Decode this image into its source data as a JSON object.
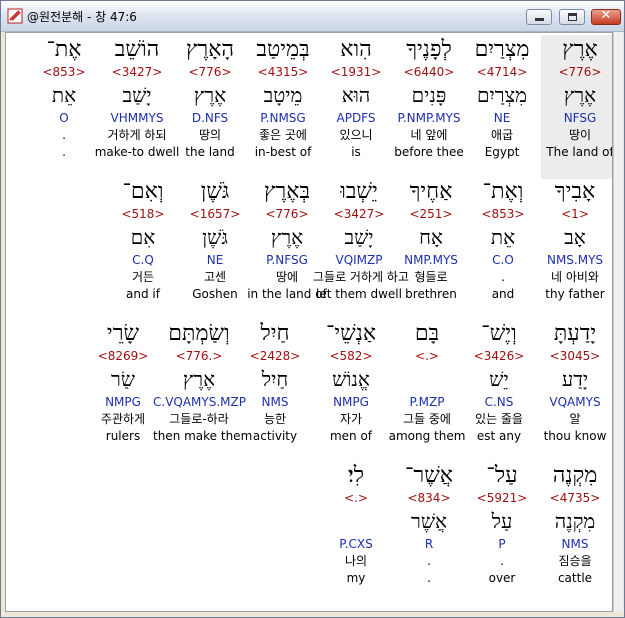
{
  "window": {
    "title": "@원전분해 - 창 47:6",
    "close_glyph": "✕"
  },
  "rows": [
    {
      "words": [
        {
          "heb": "אֶרֶץ",
          "strong": "<776>",
          "lex": "אֶרֶץ",
          "morph": "NFSG",
          "kor": "땅이",
          "eng": "The land of",
          "highlight": true
        },
        {
          "heb": "מִצְרַיִם",
          "strong": "<4714>",
          "lex": "מִצְרַיִם",
          "morph": "NE",
          "kor": "애굽",
          "eng": "Egypt"
        },
        {
          "heb": "לְפָנֶיךָ",
          "strong": "<6440>",
          "lex": "פָּנִים",
          "morph": "P.NMP.MYS",
          "kor": "네 앞에",
          "eng": "before thee"
        },
        {
          "heb": "הִוא",
          "strong": "<1931>",
          "lex": "הוּא",
          "morph": "APDFS",
          "kor": "있으니",
          "eng": "is"
        },
        {
          "heb": "בְּמֵיטַב",
          "strong": "<4315>",
          "lex": "מֵיטָב",
          "morph": "P.NMSG",
          "kor": "좋은 곳에",
          "eng": "in-best of"
        },
        {
          "heb": "הָאָרֶץ",
          "strong": "<776>",
          "lex": "אֶרֶץ",
          "morph": "D.NFS",
          "kor": "땅의",
          "eng": "the land"
        },
        {
          "heb": "הוֹשֵׁב",
          "strong": "<3427>",
          "lex": "יָשַׁב",
          "morph": "VHMMYS",
          "kor": "거하게 하되",
          "eng": "make-to dwell"
        },
        {
          "heb": "אֶת־",
          "strong": "<853>",
          "lex": "אֵת",
          "morph": "O",
          "kor": ".",
          "eng": "."
        }
      ]
    },
    {
      "words": [
        {
          "heb": "אָבִיךָ",
          "strong": "<1>",
          "lex": "אָב",
          "morph": "NMS.MYS",
          "kor": "네 아비와",
          "eng": "thy father"
        },
        {
          "heb": "וְאֶת־",
          "strong": "<853>",
          "lex": "אֵת",
          "morph": "C.O",
          "kor": ".",
          "eng": "and"
        },
        {
          "heb": "אַחֶיךָ",
          "strong": "<251>",
          "lex": "אָח",
          "morph": "NMP.MYS",
          "kor": "형들로",
          "eng": "brethren"
        },
        {
          "heb": "יֵשְׁבוּ",
          "strong": "<3427>",
          "lex": "יָשַׁב",
          "morph": "VQIMZP",
          "kor": "그들로 거하게 하고",
          "eng": "let them dwell"
        },
        {
          "heb": "בְּאֶרֶץ",
          "strong": "<776>",
          "lex": "אֶרֶץ",
          "morph": "P.NFSG",
          "kor": "땅에",
          "eng": "in the land of"
        },
        {
          "heb": "גֹּשֶׁן",
          "strong": "<1657>",
          "lex": "גֹּשֶׁן",
          "morph": "NE",
          "kor": "고센",
          "eng": "Goshen"
        },
        {
          "heb": "וְאִם־",
          "strong": "<518>",
          "lex": "אִם",
          "morph": "C.Q",
          "kor": "거든",
          "eng": "and if"
        }
      ]
    },
    {
      "words": [
        {
          "heb": "יָדַעְתָּ",
          "strong": "<3045>",
          "lex": "יָדַע",
          "morph": "VQAMYS",
          "kor": "알",
          "eng": "thou know"
        },
        {
          "heb": "וְיֶשׁ־",
          "strong": "<3426>",
          "lex": "יֵשׁ",
          "morph": "C.NS",
          "kor": "있는 줄을",
          "eng": "est any"
        },
        {
          "heb": "בָּם",
          "strong": "<.>",
          "lex": "",
          "morph": "P.MZP",
          "kor": "그들 중에",
          "eng": "among them"
        },
        {
          "heb": "אַנְשֵׁי־",
          "strong": "<582>",
          "lex": "אֱנוֹשׁ",
          "morph": "NMPG",
          "kor": "자가",
          "eng": "men of"
        },
        {
          "heb": "חַיִל",
          "strong": "<2428>",
          "lex": "חַיִל",
          "morph": "NMS",
          "kor": "능한",
          "eng": "activity"
        },
        {
          "heb": "וְשַׂמְתָּם",
          "strong": "<776.>",
          "lex": "אֶרֶץ",
          "morph": "C.VQAMYS.MZP",
          "kor": "그들로-하라",
          "eng": "then make them"
        },
        {
          "heb": "שָׂרֵי",
          "strong": "<8269>",
          "lex": "שַׂר",
          "morph": "NMPG",
          "kor": "주관하게",
          "eng": "rulers"
        }
      ]
    },
    {
      "words": [
        {
          "heb": "מִקְנֶה",
          "strong": "<4735>",
          "lex": "מִקְנֶה",
          "morph": "NMS",
          "kor": "짐승을",
          "eng": "cattle"
        },
        {
          "heb": "עַל־",
          "strong": "<5921>",
          "lex": "עַל",
          "morph": "P",
          "kor": ".",
          "eng": "over"
        },
        {
          "heb": "אֲשֶׁר־",
          "strong": "<834>",
          "lex": "אֲשֶׁר",
          "morph": "R",
          "kor": ".",
          "eng": "."
        },
        {
          "heb": "לִי׃",
          "strong": "<.>",
          "lex": "",
          "morph": "P.CXS",
          "kor": "나의",
          "eng": "my"
        }
      ]
    }
  ]
}
